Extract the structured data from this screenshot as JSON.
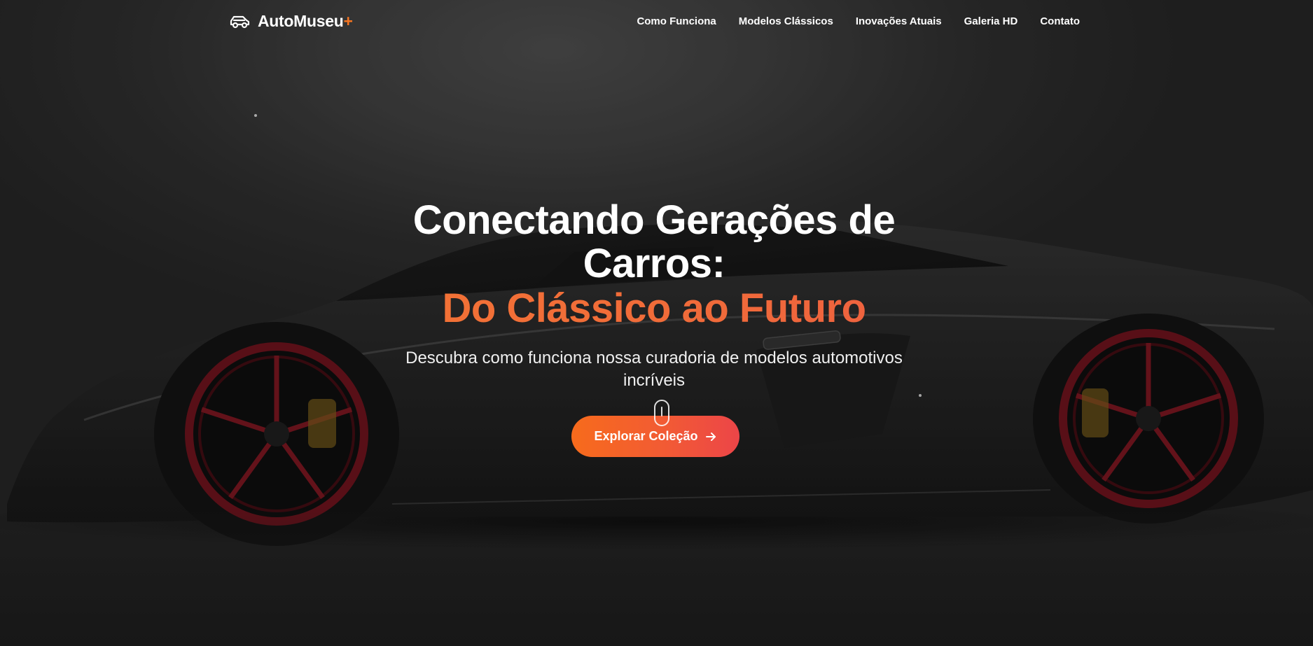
{
  "brand": {
    "name": "AutoMuseu",
    "plus": "+",
    "accent_color": "#f47421",
    "icon": "car-icon"
  },
  "nav": {
    "links": [
      {
        "label": "Como Funciona"
      },
      {
        "label": "Modelos Clássicos"
      },
      {
        "label": "Inovações Atuais"
      },
      {
        "label": "Galeria HD"
      },
      {
        "label": "Contato"
      }
    ]
  },
  "hero": {
    "title_line1": "Conectando Gerações de",
    "title_line2": "Carros:",
    "title_accent": "Do Clássico ao Futuro",
    "subtitle": "Descubra como funciona nossa curadoria de modelos automotivos incríveis",
    "cta_label": "Explorar Coleção",
    "cta_icon": "arrow-right-icon",
    "cta_gradient": [
      "#f76b1c",
      "#ec4548"
    ],
    "background_image": "dark sports car with red wheels"
  }
}
